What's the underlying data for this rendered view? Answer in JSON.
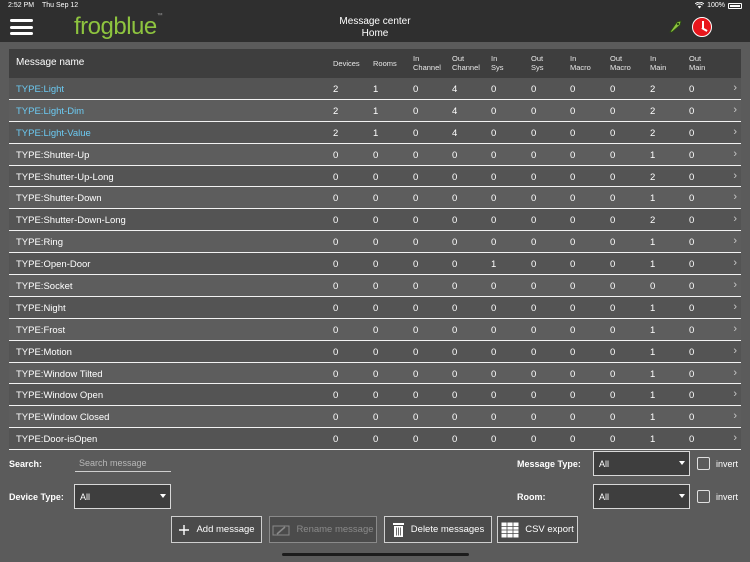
{
  "status": {
    "time": "2:52 PM",
    "date": "Thu Sep 12",
    "battery": "100%"
  },
  "header": {
    "logo": "frogblue",
    "logo_tm": "™",
    "title": "Message center",
    "subtitle": "Home"
  },
  "table": {
    "headers": {
      "name": "Message name",
      "devices": "Devices",
      "rooms": "Rooms",
      "in_channel": [
        "In",
        "Channel"
      ],
      "out_channel": [
        "Out",
        "Channel"
      ],
      "in_sys": [
        "In",
        "Sys"
      ],
      "out_sys": [
        "Out",
        "Sys"
      ],
      "in_macro": [
        "In",
        "Macro"
      ],
      "out_macro": [
        "Out",
        "Macro"
      ],
      "in_main": [
        "In",
        "Main"
      ],
      "out_main": [
        "Out",
        "Main"
      ]
    },
    "rows": [
      {
        "name": "TYPE:Light",
        "highlight": true,
        "v": [
          "2",
          "1",
          "0",
          "4",
          "0",
          "0",
          "0",
          "0",
          "2",
          "0"
        ]
      },
      {
        "name": "TYPE:Light-Dim",
        "highlight": true,
        "v": [
          "2",
          "1",
          "0",
          "4",
          "0",
          "0",
          "0",
          "0",
          "2",
          "0"
        ]
      },
      {
        "name": "TYPE:Light-Value",
        "highlight": true,
        "v": [
          "2",
          "1",
          "0",
          "4",
          "0",
          "0",
          "0",
          "0",
          "2",
          "0"
        ]
      },
      {
        "name": "TYPE:Shutter-Up",
        "highlight": false,
        "v": [
          "0",
          "0",
          "0",
          "0",
          "0",
          "0",
          "0",
          "0",
          "1",
          "0"
        ]
      },
      {
        "name": "TYPE:Shutter-Up-Long",
        "highlight": false,
        "v": [
          "0",
          "0",
          "0",
          "0",
          "0",
          "0",
          "0",
          "0",
          "2",
          "0"
        ]
      },
      {
        "name": "TYPE:Shutter-Down",
        "highlight": false,
        "v": [
          "0",
          "0",
          "0",
          "0",
          "0",
          "0",
          "0",
          "0",
          "1",
          "0"
        ]
      },
      {
        "name": "TYPE:Shutter-Down-Long",
        "highlight": false,
        "v": [
          "0",
          "0",
          "0",
          "0",
          "0",
          "0",
          "0",
          "0",
          "2",
          "0"
        ]
      },
      {
        "name": "TYPE:Ring",
        "highlight": false,
        "v": [
          "0",
          "0",
          "0",
          "0",
          "0",
          "0",
          "0",
          "0",
          "1",
          "0"
        ]
      },
      {
        "name": "TYPE:Open-Door",
        "highlight": false,
        "v": [
          "0",
          "0",
          "0",
          "0",
          "1",
          "0",
          "0",
          "0",
          "1",
          "0"
        ]
      },
      {
        "name": "TYPE:Socket",
        "highlight": false,
        "v": [
          "0",
          "0",
          "0",
          "0",
          "0",
          "0",
          "0",
          "0",
          "0",
          "0"
        ]
      },
      {
        "name": "TYPE:Night",
        "highlight": false,
        "v": [
          "0",
          "0",
          "0",
          "0",
          "0",
          "0",
          "0",
          "0",
          "1",
          "0"
        ]
      },
      {
        "name": "TYPE:Frost",
        "highlight": false,
        "v": [
          "0",
          "0",
          "0",
          "0",
          "0",
          "0",
          "0",
          "0",
          "1",
          "0"
        ]
      },
      {
        "name": "TYPE:Motion",
        "highlight": false,
        "v": [
          "0",
          "0",
          "0",
          "0",
          "0",
          "0",
          "0",
          "0",
          "1",
          "0"
        ]
      },
      {
        "name": "TYPE:Window Tilted",
        "highlight": false,
        "v": [
          "0",
          "0",
          "0",
          "0",
          "0",
          "0",
          "0",
          "0",
          "1",
          "0"
        ]
      },
      {
        "name": "TYPE:Window Open",
        "highlight": false,
        "v": [
          "0",
          "0",
          "0",
          "0",
          "0",
          "0",
          "0",
          "0",
          "1",
          "0"
        ]
      },
      {
        "name": "TYPE:Window Closed",
        "highlight": false,
        "v": [
          "0",
          "0",
          "0",
          "0",
          "0",
          "0",
          "0",
          "0",
          "1",
          "0"
        ]
      },
      {
        "name": "TYPE:Door-isOpen",
        "highlight": false,
        "v": [
          "0",
          "0",
          "0",
          "0",
          "0",
          "0",
          "0",
          "0",
          "1",
          "0"
        ]
      }
    ]
  },
  "filters": {
    "search_label": "Search:",
    "search_placeholder": "Search message",
    "search_value": "",
    "device_type_label": "Device Type:",
    "device_type_value": "All",
    "message_type_label": "Message Type:",
    "message_type_value": "All",
    "room_label": "Room:",
    "room_value": "All",
    "invert_label": "invert"
  },
  "buttons": {
    "add": "Add message",
    "rename": "Rename message",
    "delete": "Delete messages",
    "csv": "CSV export"
  },
  "colors": {
    "accent_link": "#6ccaf2",
    "logo": "#8ec43f",
    "clock": "#e8161c"
  },
  "icons": {
    "menu": "menu-icon",
    "bug": "bug-icon",
    "clock": "clock-icon",
    "add": "plus-icon",
    "rename": "rename-icon",
    "delete": "trash-icon",
    "csv": "grid-icon",
    "chevron": "chevron-right-icon"
  }
}
